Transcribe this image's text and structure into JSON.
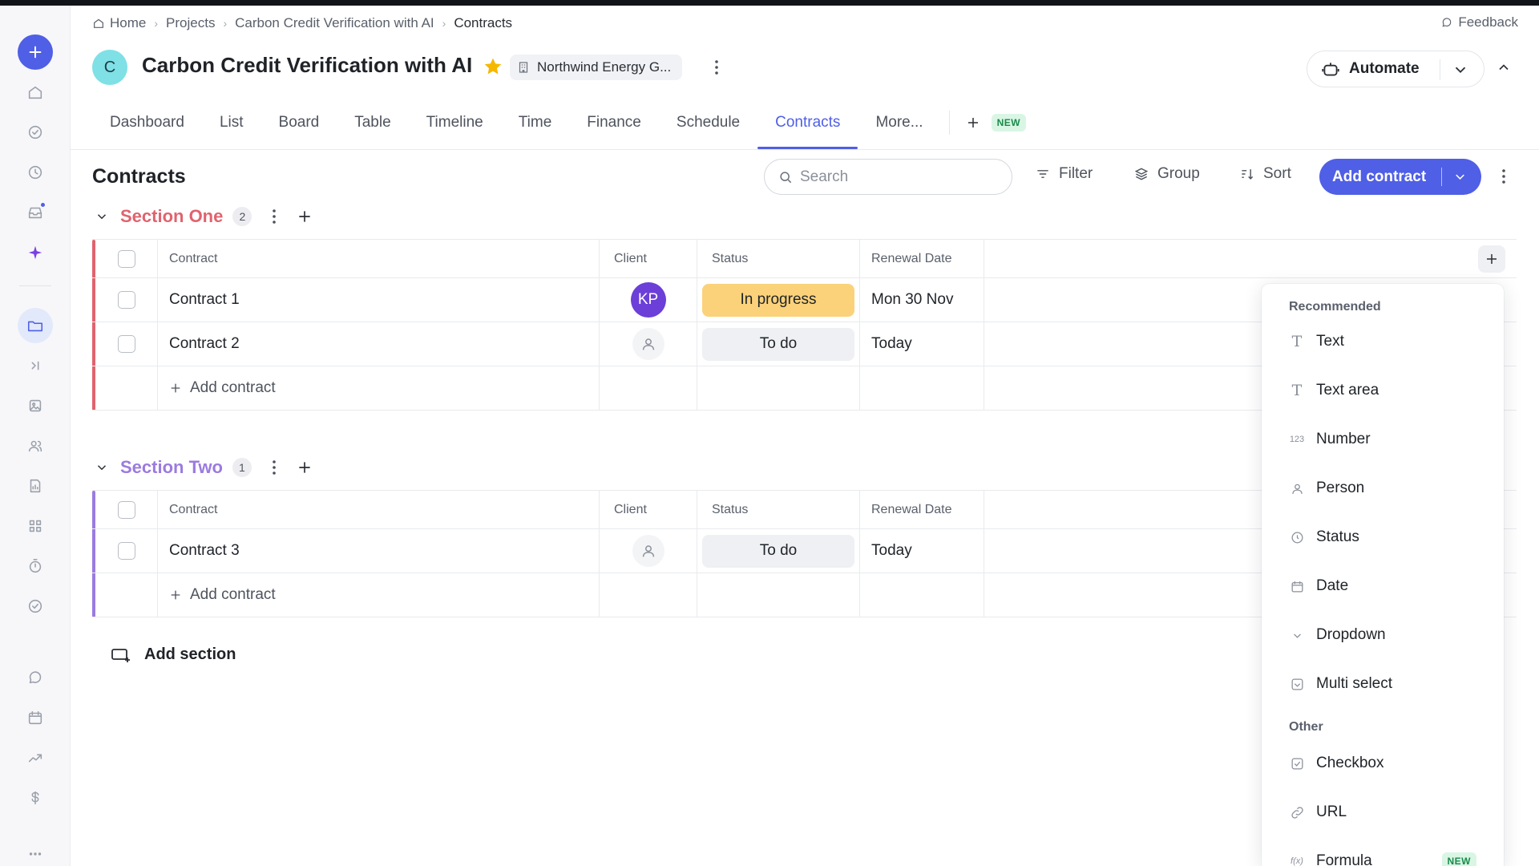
{
  "breadcrumb": [
    "Home",
    "Projects",
    "Carbon Credit Verification with AI",
    "Contracts"
  ],
  "feedback_label": "Feedback",
  "project": {
    "avatar_letter": "C",
    "title": "Carbon Credit Verification with AI",
    "org": "Northwind Energy G...",
    "automate_label": "Automate"
  },
  "tabs": [
    "Dashboard",
    "List",
    "Board",
    "Table",
    "Timeline",
    "Time",
    "Finance",
    "Schedule",
    "Contracts",
    "More..."
  ],
  "active_tab": "Contracts",
  "new_badge": "NEW",
  "toolbar": {
    "page_title": "Contracts",
    "search_placeholder": "Search",
    "filter_label": "Filter",
    "group_label": "Group",
    "sort_label": "Sort",
    "add_label": "Add contract"
  },
  "columns": [
    "Contract",
    "Client",
    "Status",
    "Renewal Date"
  ],
  "sections": [
    {
      "name": "Section One",
      "count": "2",
      "color": "#e0636e",
      "rows": [
        {
          "contract": "Contract 1",
          "client": "KP",
          "status": "In progress",
          "status_color": "#fbd27a",
          "renewal": "Mon 30 Nov"
        },
        {
          "contract": "Contract 2",
          "client": "",
          "status": "To do",
          "status_color": "#eef0f3",
          "renewal": "Today"
        }
      ],
      "add_row_label": "Add contract"
    },
    {
      "name": "Section Two",
      "count": "1",
      "color": "#9b7be0",
      "rows": [
        {
          "contract": "Contract 3",
          "client": "",
          "status": "To do",
          "status_color": "#eef0f3",
          "renewal": "Today"
        }
      ],
      "add_row_label": "Add contract"
    }
  ],
  "add_section_label": "Add section",
  "field_menu": {
    "recommended_label": "Recommended",
    "recommended": [
      {
        "label": "Text",
        "icon": "text-icon"
      },
      {
        "label": "Text area",
        "icon": "text-area-icon"
      },
      {
        "label": "Number",
        "icon": "number-icon",
        "glyph": "123"
      },
      {
        "label": "Person",
        "icon": "person-icon"
      },
      {
        "label": "Status",
        "icon": "status-icon"
      },
      {
        "label": "Date",
        "icon": "calendar-icon"
      },
      {
        "label": "Dropdown",
        "icon": "chevron-down-icon"
      },
      {
        "label": "Multi select",
        "icon": "multi-select-icon"
      }
    ],
    "other_label": "Other",
    "other": [
      {
        "label": "Checkbox",
        "icon": "checkbox-icon"
      },
      {
        "label": "URL",
        "icon": "link-icon"
      },
      {
        "label": "Formula",
        "icon": "formula-icon",
        "glyph": "f(x)",
        "badge": "NEW"
      }
    ]
  },
  "colors": {
    "accent": "#4f5fe6",
    "star": "#f5b800",
    "avatar_kp": "#6b3fd8"
  }
}
